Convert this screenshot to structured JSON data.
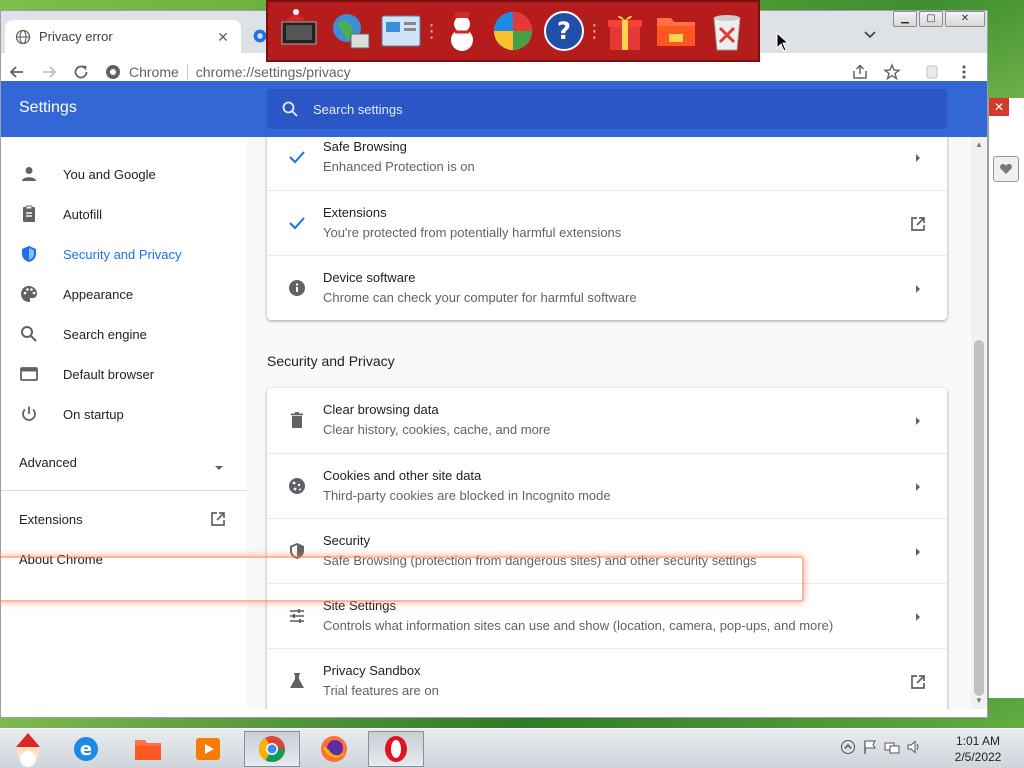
{
  "browser": {
    "tab": {
      "title": "Privacy error",
      "icon": "globe-icon"
    },
    "omnibox": {
      "chip": "Chrome",
      "url": "chrome://settings/privacy"
    }
  },
  "settings": {
    "title": "Settings",
    "search_placeholder": "Search settings",
    "sidebar": {
      "items": [
        {
          "label": "You and Google",
          "icon": "person-icon"
        },
        {
          "label": "Autofill",
          "icon": "clipboard-icon"
        },
        {
          "label": "Security and Privacy",
          "icon": "shield-icon",
          "active": true
        },
        {
          "label": "Appearance",
          "icon": "palette-icon"
        },
        {
          "label": "Search engine",
          "icon": "search-icon"
        },
        {
          "label": "Default browser",
          "icon": "browser-window-icon"
        },
        {
          "label": "On startup",
          "icon": "power-icon"
        }
      ],
      "advanced": "Advanced",
      "extensions": "Extensions",
      "about": "About Chrome"
    },
    "top_card": [
      {
        "title": "Safe Browsing",
        "subtitle": "Enhanced Protection is on",
        "icon": "check-icon",
        "action": "arrow-right-icon"
      },
      {
        "title": "Extensions",
        "subtitle": "You're protected from potentially harmful extensions",
        "icon": "check-icon",
        "action": "open-external-icon"
      },
      {
        "title": "Device software",
        "subtitle": "Chrome can check your computer for harmful software",
        "icon": "info-icon",
        "action": "arrow-right-icon"
      }
    ],
    "section_heading": "Security and Privacy",
    "privacy_card": [
      {
        "title": "Clear browsing data",
        "subtitle": "Clear history, cookies, cache, and more",
        "icon": "trash-icon",
        "action": "arrow-right-icon"
      },
      {
        "title": "Cookies and other site data",
        "subtitle": "Third-party cookies are blocked in Incognito mode",
        "icon": "cookie-icon",
        "action": "arrow-right-icon"
      },
      {
        "title": "Security",
        "subtitle": "Safe Browsing (protection from dangerous sites) and other security settings",
        "icon": "shield-icon",
        "action": "arrow-right-icon"
      },
      {
        "title": "Site Settings",
        "subtitle": "Controls what information sites can use and show (location, camera, pop-ups, and more)",
        "icon": "sliders-icon",
        "action": "arrow-right-icon"
      },
      {
        "title": "Privacy Sandbox",
        "subtitle": "Trial features are on",
        "icon": "flask-icon",
        "action": "open-external-icon"
      }
    ]
  },
  "taskbar": {
    "clock_time": "1:01 AM",
    "clock_date": "2/5/2022"
  },
  "colors": {
    "header_blue": "#3367d6",
    "active_blue": "#1a73e8",
    "icon_bar_red": "#b51c1c"
  }
}
